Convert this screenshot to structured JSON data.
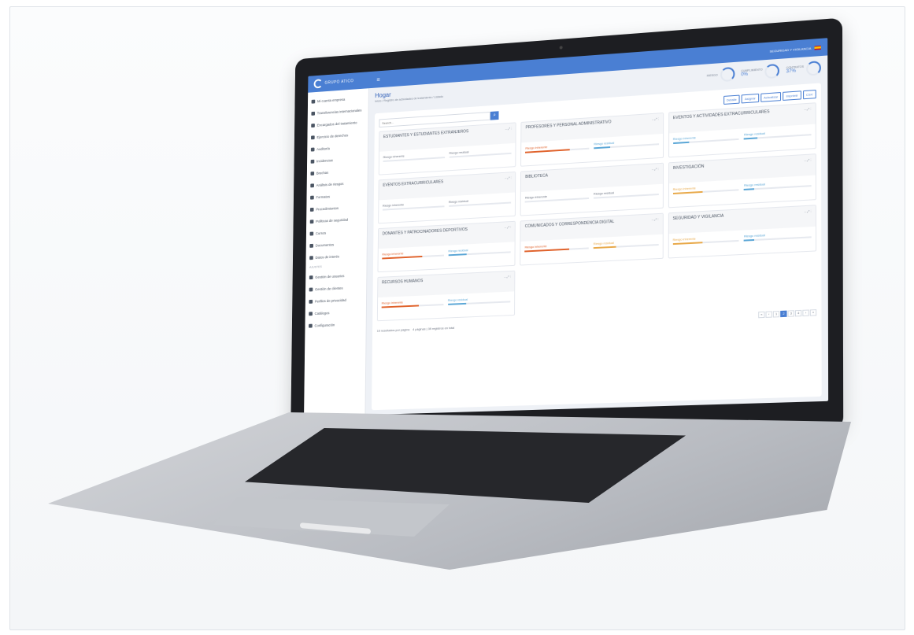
{
  "app": {
    "brand": "GRUPO ATICO",
    "topbar_text": "SEGURIDAD Y VIGILANCIA"
  },
  "header": {
    "title": "Hogar",
    "breadcrumb": "Inicio / Registro de actividades de tratamiento / Listado",
    "kpis": [
      {
        "label": "RIESGO",
        "value": ""
      },
      {
        "label": "CUMPLIMIENTO",
        "value": "0%"
      },
      {
        "label": "CONTRATOS",
        "value": "37%"
      }
    ]
  },
  "sidebar": {
    "items": [
      {
        "label": "Mi cuenta empresa"
      },
      {
        "label": "Transferencias internacionales"
      },
      {
        "label": "Encargados del tratamiento"
      },
      {
        "label": "Ejercicio de derechos"
      },
      {
        "label": "Auditoría"
      },
      {
        "label": "Incidencias"
      },
      {
        "label": "Brechas"
      },
      {
        "label": "Análisis de riesgos"
      },
      {
        "label": "Formatos"
      },
      {
        "label": "Procedimientos"
      },
      {
        "label": "Políticas de seguridad"
      },
      {
        "label": "Cursos"
      },
      {
        "label": "Documentos"
      },
      {
        "label": "Datos de interés"
      }
    ],
    "section": "AJUSTES",
    "settings_items": [
      {
        "label": "Gestión de usuarios"
      },
      {
        "label": "Gestión de clientes"
      },
      {
        "label": "Perfiles de privacidad"
      },
      {
        "label": "Catálogos"
      },
      {
        "label": "Configuración"
      }
    ]
  },
  "toolbar": {
    "search_placeholder": "Search...",
    "buttons": [
      "Detalle",
      "Asignar",
      "Actualizar",
      "Imprimir",
      "CSV"
    ]
  },
  "cards": [
    {
      "title": "ESTUDIANTES Y ESTUDIANTES EXTRANJEROS",
      "inherent": 0,
      "residual": 0,
      "inherent_color": "#9aa2ae",
      "residual_color": "#9aa2ae"
    },
    {
      "title": "PROFESORES Y PERSONAL ADMINISTRATIVO",
      "inherent": 0.7,
      "residual": 0.25,
      "inherent_color": "#e0622b",
      "residual_color": "#5aa6d6"
    },
    {
      "title": "EVENTOS Y ACTIVIDADES EXTRACURRICULARES",
      "inherent": 0.25,
      "residual": 0.2,
      "inherent_color": "#5aa6d6",
      "residual_color": "#5aa6d6"
    },
    {
      "title": "EVENTOS EXTRACURRICULARES",
      "inherent": 0,
      "residual": 0,
      "inherent_color": "#9aa2ae",
      "residual_color": "#9aa2ae"
    },
    {
      "title": "BIBLIOTECA",
      "inherent": 0,
      "residual": 0,
      "inherent_color": "#9aa2ae",
      "residual_color": "#9aa2ae"
    },
    {
      "title": "INVESTIGACIÓN",
      "inherent": 0.45,
      "residual": 0.15,
      "inherent_color": "#e8a94a",
      "residual_color": "#5aa6d6"
    },
    {
      "title": "DONANTES Y PATROCINADORES DEPORTIVOS",
      "inherent": 0.65,
      "residual": 0.3,
      "inherent_color": "#e0622b",
      "residual_color": "#5aa6d6"
    },
    {
      "title": "COMUNICADOS Y CORRESPONDENCIA DIGITAL",
      "inherent": 0.7,
      "residual": 0.35,
      "inherent_color": "#e0622b",
      "residual_color": "#e8a94a"
    },
    {
      "title": "SEGURIDAD Y VIGILANCIA",
      "inherent": 0.45,
      "residual": 0.15,
      "inherent_color": "#e8a94a",
      "residual_color": "#5aa6d6"
    },
    {
      "title": "RECURSOS HUMANOS",
      "inherent": 0.6,
      "residual": 0.3,
      "inherent_color": "#e0622b",
      "residual_color": "#5aa6d6"
    }
  ],
  "labels": {
    "inherent": "Riesgo inherente",
    "residual": "Riesgo residual"
  },
  "footer": {
    "per_page": "10 resultados por página",
    "summary": "4 páginas | 35 registros en total",
    "pages": [
      "«",
      "‹",
      "1",
      "2",
      "3",
      "4",
      "›",
      "»"
    ],
    "active_page": "2"
  },
  "colors": {
    "accent": "#4a7fd3"
  }
}
